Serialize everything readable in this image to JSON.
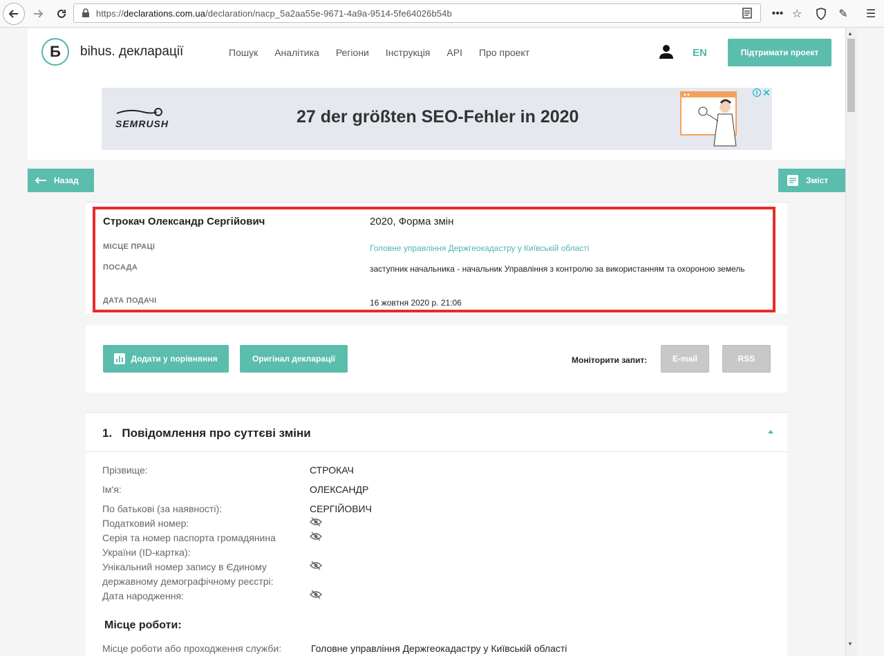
{
  "browser": {
    "url_prefix": "https://",
    "url_domain": "declarations.com.ua",
    "url_path": "/declaration/nacp_5a2aa55e-9671-4a9a-9514-5fe64026b54b"
  },
  "header": {
    "logo_letter": "Ƃ",
    "site_name": "bihus. декларації",
    "nav": [
      "Пошук",
      "Аналітика",
      "Регіони",
      "Інструкція",
      "API",
      "Про проект"
    ],
    "lang": "EN",
    "support_button": "Підтримати проект"
  },
  "ad": {
    "brand": "SEMRUSH",
    "headline": "27 der größten SEO-Fehler in 2020",
    "info": "i",
    "close": "✕"
  },
  "back_button": "Назад",
  "contents_button": "Зміст",
  "summary": {
    "name": "Строкач Олександр Сергійович",
    "declaration_title": "2020, Форма змін",
    "workplace_label": "МІСЦЕ ПРАЦІ",
    "workplace_value": "Головне управління Держгеокадастру у Київській області",
    "position_label": "ПОСАДА",
    "position_value": "заступник начальника - начальник Управління з контролю за використанням та охороною земель",
    "date_label": "ДАТА ПОДАЧІ",
    "date_value": "16 жовтня 2020 р. 21:06"
  },
  "actions": {
    "compare_button": "Додати у порівняння",
    "original_button": "Оригінал декларації",
    "monitor_label": "Моніторити запит:",
    "email_button": "E-mail",
    "rss_button": "RSS"
  },
  "section1": {
    "title": "1.   Повідомлення про суттєві зміни",
    "rows": [
      {
        "label": "Прізвище:",
        "value": "СТРОКАЧ"
      },
      {
        "label": "Ім'я:",
        "value": "ОЛЕКСАНДР"
      },
      {
        "label": "По батькові (за наявності):",
        "value": "СЕРГІЙОВИЧ"
      },
      {
        "label": "Податковий номер:",
        "value": ""
      },
      {
        "label": "Серія та номер паспорта громадянина України (ID-картка):",
        "value": ""
      },
      {
        "label": "Унікальний номер запису в Єдиному державному демографічному реєстрі:",
        "value": ""
      },
      {
        "label": "Дата народження:",
        "value": ""
      }
    ],
    "subheading": "Місце роботи:",
    "workplace_row_label": "Місце роботи або проходження служби:",
    "workplace_row_value": "Головне управління Держгеокадастру у Київській області"
  },
  "colors": {
    "accent": "#5bbdab",
    "highlight": "#e92a2a"
  }
}
